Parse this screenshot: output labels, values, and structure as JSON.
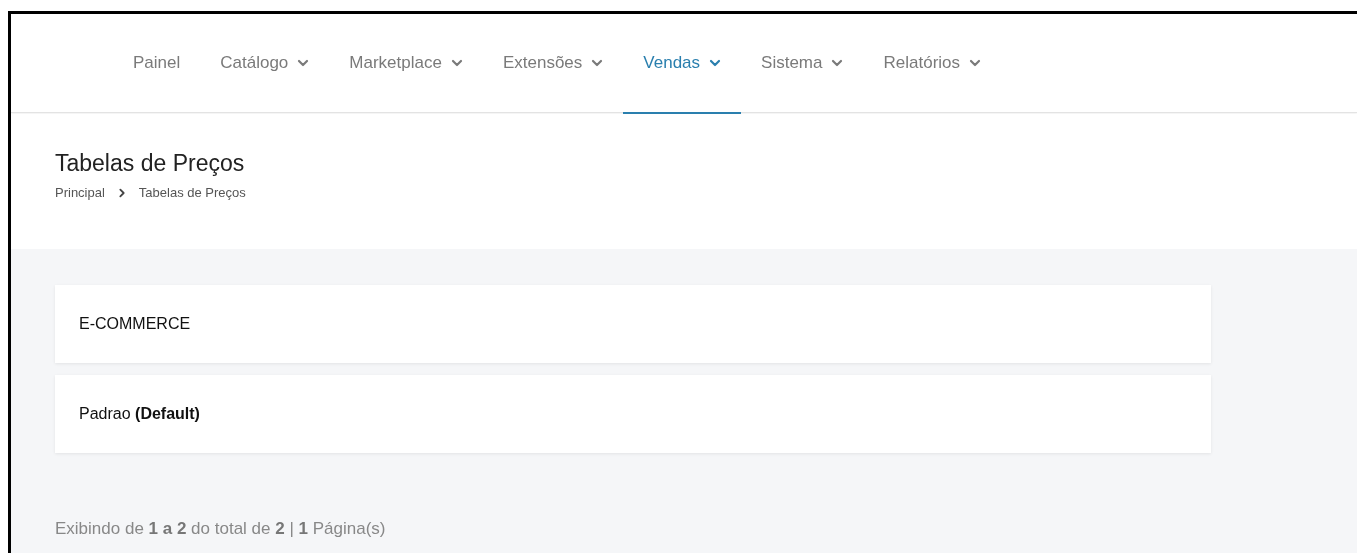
{
  "nav": {
    "items": [
      {
        "label": "Painel",
        "kind": "link",
        "selected": false
      },
      {
        "label": "Catálogo",
        "kind": "dropdown",
        "selected": false
      },
      {
        "label": "Marketplace",
        "kind": "dropdown",
        "selected": false
      },
      {
        "label": "Extensões",
        "kind": "dropdown",
        "selected": false
      },
      {
        "label": "Vendas",
        "kind": "dropdown",
        "selected": true
      },
      {
        "label": "Sistema",
        "kind": "dropdown",
        "selected": false
      },
      {
        "label": "Relatórios",
        "kind": "dropdown",
        "selected": false
      }
    ]
  },
  "header": {
    "title": "Tabelas de Preços",
    "breadcrumb": [
      "Principal",
      "Tabelas de Preços"
    ]
  },
  "price_tables": [
    {
      "name": "E-COMMERCE"
    },
    {
      "name": "Padrao **(Default)**"
    }
  ],
  "pagination": {
    "summary": "Exibindo de **1 a 2** do total de **2** | **1** Página(s)"
  }
}
